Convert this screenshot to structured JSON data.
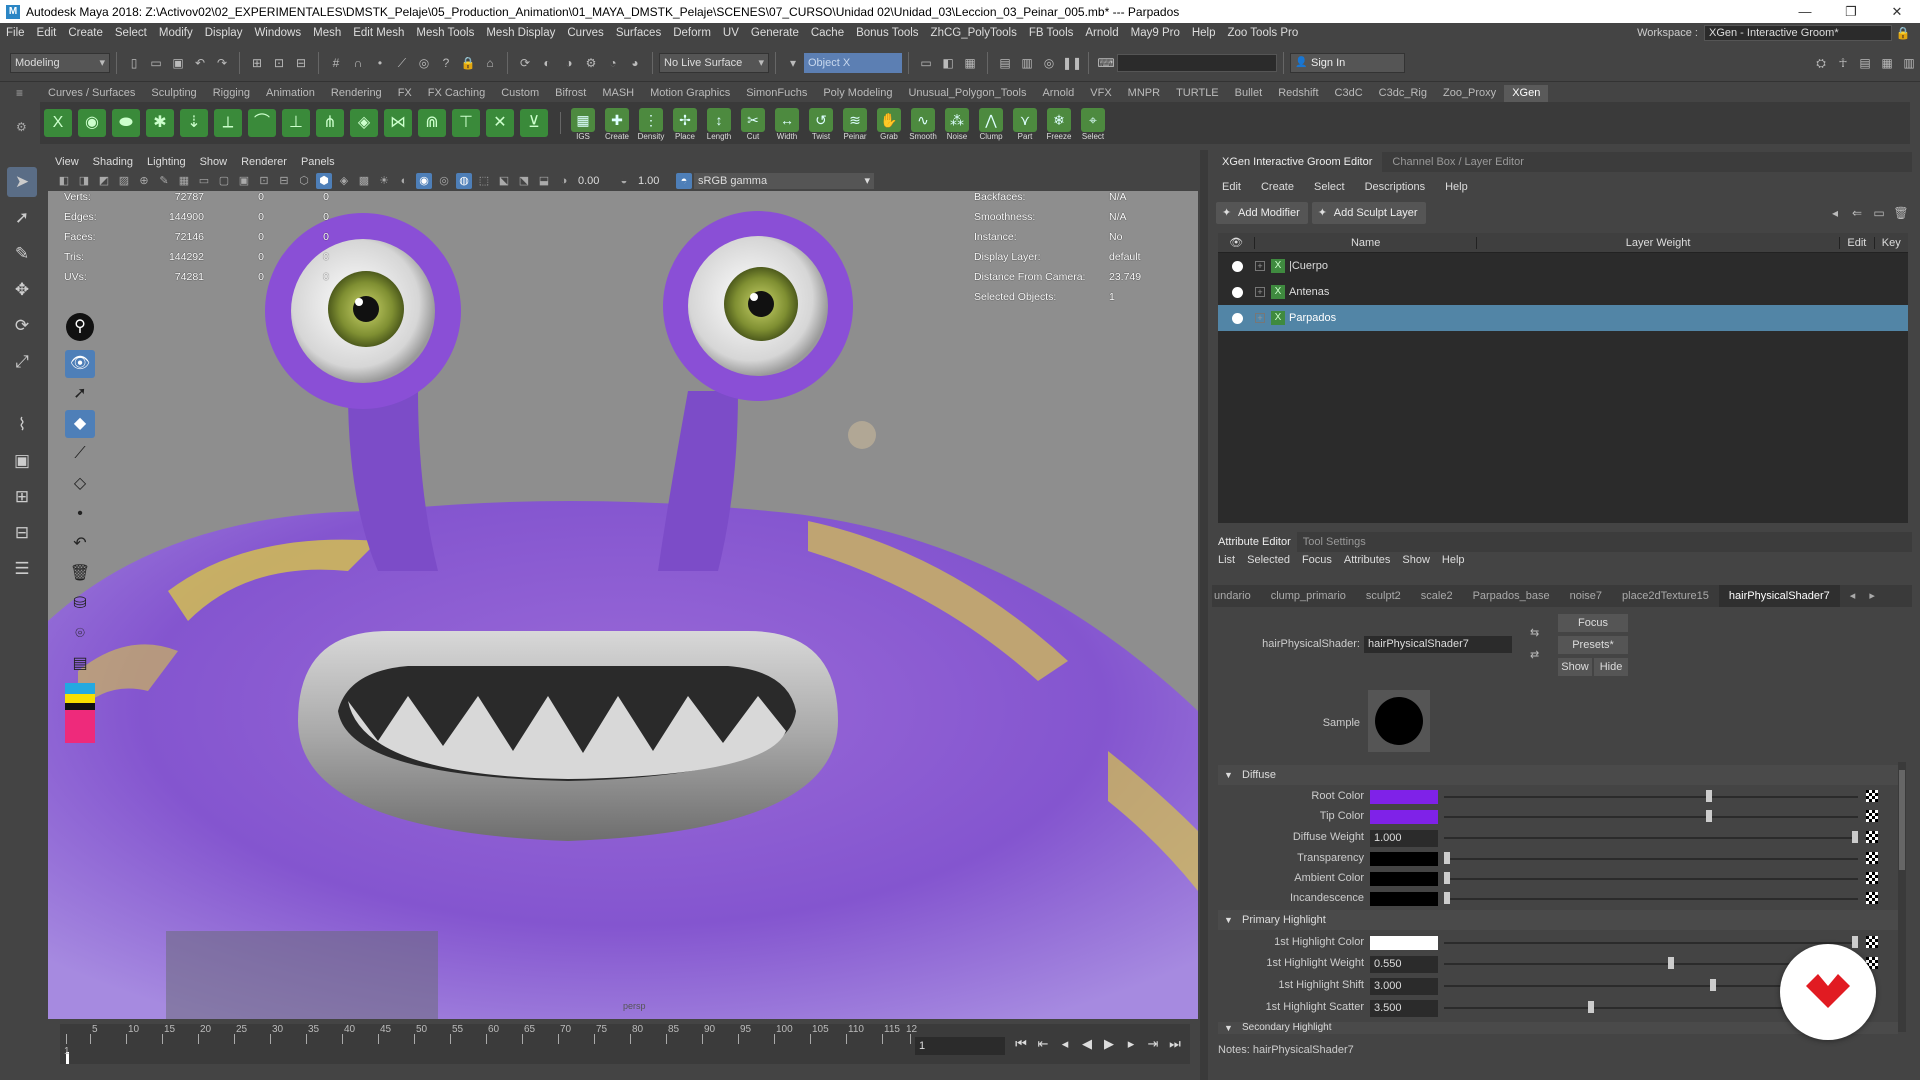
{
  "window": {
    "title": "Autodesk Maya 2018: Z:\\Activov02\\02_EXPERIMENTALES\\DMSTK_Pelaje\\05_Production_Animation\\01_MAYA_DMSTK_Pelaje\\SCENES\\07_CURSO\\Unidad 02\\Unidad_03\\Leccion_03_Peinar_005.mb*   ---   Parpados",
    "minimize": "—",
    "maximize": "❐",
    "close": "✕"
  },
  "menubar": {
    "items": [
      "File",
      "Edit",
      "Create",
      "Select",
      "Modify",
      "Display",
      "Windows",
      "Mesh",
      "Edit Mesh",
      "Mesh Tools",
      "Mesh Display",
      "Curves",
      "Surfaces",
      "Deform",
      "UV",
      "Generate",
      "Cache",
      "Bonus Tools",
      "ZhCG_PolyTools",
      "FB Tools",
      "Arnold",
      "May9 Pro",
      "Help",
      "Zoo Tools Pro"
    ],
    "workspace_label": "Workspace :",
    "workspace_value": "XGen - Interactive Groom*"
  },
  "statusline": {
    "mode": "Modeling",
    "live_surface": "No Live Surface",
    "object_field": "Object X",
    "sign_in": "Sign In"
  },
  "shelf": {
    "tabs": [
      "Curves / Surfaces",
      "Sculpting",
      "Rigging",
      "Animation",
      "Rendering",
      "FX",
      "FX Caching",
      "Custom",
      "Bifrost",
      "MASH",
      "Motion Graphics",
      "SimonFuchs",
      "Poly Modeling",
      "Unusual_Polygon_Tools",
      "Arnold",
      "VFX",
      "MNPR",
      "TURTLE",
      "Bullet",
      "Redshift",
      "C3dC",
      "C3dc_Rig",
      "Zoo_Proxy",
      "XGen"
    ],
    "active_tab": "XGen",
    "buttons": [
      "IGS",
      "Create",
      "Density",
      "Place",
      "Length",
      "Cut",
      "Width",
      "Twist",
      "Peinar",
      "Grab",
      "Smooth",
      "Noise",
      "Clump",
      "Part",
      "Freeze",
      "Select"
    ]
  },
  "viewport": {
    "menu": [
      "View",
      "Shading",
      "Lighting",
      "Show",
      "Renderer",
      "Panels"
    ],
    "value_a": "0.00",
    "value_b": "1.00",
    "color_space": "sRGB gamma",
    "camera_label": "persp",
    "hud_left": [
      {
        "label": "Verts:",
        "v1": "72787",
        "v2": "0",
        "v3": "0"
      },
      {
        "label": "Edges:",
        "v1": "144900",
        "v2": "0",
        "v3": "0"
      },
      {
        "label": "Faces:",
        "v1": "72146",
        "v2": "0",
        "v3": "0"
      },
      {
        "label": "Tris:",
        "v1": "144292",
        "v2": "0",
        "v3": "0"
      },
      {
        "label": "UVs:",
        "v1": "74281",
        "v2": "0",
        "v3": "0"
      }
    ],
    "hud_right": [
      {
        "label": "Backfaces:",
        "value": "N/A"
      },
      {
        "label": "Smoothness:",
        "value": "N/A"
      },
      {
        "label": "Instance:",
        "value": "No"
      },
      {
        "label": "Display Layer:",
        "value": "default"
      },
      {
        "label": "Distance From Camera:",
        "value": "23.749"
      },
      {
        "label": "Selected Objects:",
        "value": "1"
      }
    ]
  },
  "timeline": {
    "ticks": [
      "1",
      "5",
      "10",
      "15",
      "20",
      "25",
      "30",
      "35",
      "40",
      "45",
      "50",
      "55",
      "60",
      "65",
      "70",
      "75",
      "80",
      "85",
      "90",
      "95",
      "100",
      "105",
      "110",
      "115",
      "12"
    ],
    "current_frame": "1"
  },
  "xgen": {
    "tabs": [
      "XGen Interactive Groom Editor",
      "Channel Box / Layer Editor"
    ],
    "menu": [
      "Edit",
      "Create",
      "Select",
      "Descriptions",
      "Help"
    ],
    "add_modifier": "Add Modifier",
    "add_sculpt_layer": "Add Sculpt Layer",
    "col_name": "Name",
    "col_layer_weight": "Layer Weight",
    "col_edit": "Edit",
    "col_key": "Key",
    "rows": [
      {
        "name": "|Cuerpo"
      },
      {
        "name": "Antenas"
      },
      {
        "name": "Parpados"
      }
    ]
  },
  "attr_editor": {
    "tabs": [
      "Attribute Editor",
      "Tool Settings"
    ],
    "menu": [
      "List",
      "Selected",
      "Focus",
      "Attributes",
      "Show",
      "Help"
    ],
    "node_tabs": [
      "undario",
      "clump_primario",
      "sculpt2",
      "scale2",
      "Parpados_base",
      "noise7",
      "place2dTexture15",
      "hairPhysicalShader7"
    ],
    "active_node_tab": "hairPhysicalShader7",
    "shader_label": "hairPhysicalShader:",
    "shader_value": "hairPhysicalShader7",
    "focus_btn": "Focus",
    "presets_btn": "Presets*",
    "show_btn": "Show",
    "hide_btn": "Hide",
    "sample_label": "Sample",
    "diffuse_section": "Diffuse",
    "root_color_label": "Root Color",
    "tip_color_label": "Tip Color",
    "diffuse_weight_label": "Diffuse Weight",
    "diffuse_weight": "1.000",
    "transparency_label": "Transparency",
    "ambient_color_label": "Ambient Color",
    "incandescence_label": "Incandescence",
    "primary_section": "Primary Highlight",
    "hl_color_label": "1st Highlight Color",
    "hl_weight_label": "1st Highlight Weight",
    "hl_weight": "0.550",
    "hl_shift_label": "1st Highlight Shift",
    "hl_shift": "3.000",
    "hl_scatter_label": "1st Highlight Scatter",
    "hl_scatter": "3.500",
    "secondary_section": "Secondary Highlight",
    "notes": "Notes:  hairPhysicalShader7",
    "colors": {
      "root": "#7f22e8",
      "tip": "#7f22e8",
      "black": "#000000",
      "white": "#ffffff"
    }
  }
}
